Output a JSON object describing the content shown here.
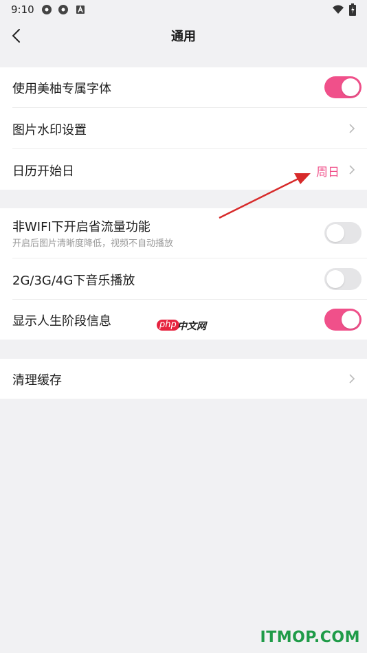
{
  "status_bar": {
    "time": "9:10"
  },
  "header": {
    "title": "通用"
  },
  "sections": {
    "s1": {
      "font_toggle": {
        "label": "使用美柚专属字体",
        "on": true
      },
      "watermark": {
        "label": "图片水印设置"
      },
      "calendar": {
        "label": "日历开始日",
        "value": "周日"
      }
    },
    "s2": {
      "data_saver": {
        "label": "非WIFI下开启省流量功能",
        "sub": "开启后图片清晰度降低，视频不自动播放",
        "on": false
      },
      "music": {
        "label": "2G/3G/4G下音乐播放",
        "on": false
      },
      "life_stage": {
        "label": "显示人生阶段信息",
        "on": true
      }
    },
    "s3": {
      "cache": {
        "label": "清理缓存"
      }
    }
  },
  "watermarks": {
    "php": "php",
    "cn": "中文网",
    "site": "ITMOP.COM"
  },
  "colors": {
    "accent": "#f0508a",
    "background": "#f1f1f3",
    "annotation_arrow": "#d72a2a"
  },
  "icons": [
    "gear-icon",
    "gear-icon",
    "a-icon",
    "wifi-icon",
    "battery-icon",
    "back-arrow-icon",
    "chevron-right-icon"
  ]
}
